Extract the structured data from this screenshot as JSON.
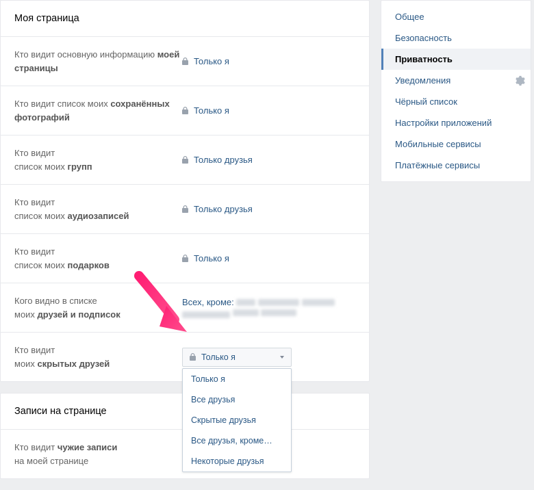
{
  "mypage": {
    "header": "Моя страница",
    "rows": [
      {
        "label_pre": "Кто видит основную информацию ",
        "label_bold": "моей страницы",
        "value": "Только я",
        "lock": true
      },
      {
        "label_pre": "Кто видит список моих ",
        "label_bold": "сохранённых фотографий",
        "value": "Только я",
        "lock": true
      },
      {
        "label_pre": "Кто видит\nсписок моих ",
        "label_bold": "групп",
        "value": "Только друзья",
        "lock": true
      },
      {
        "label_pre": "Кто видит\nсписок моих ",
        "label_bold": "аудиозаписей",
        "value": "Только друзья",
        "lock": true
      },
      {
        "label_pre": "Кто видит\nсписок моих ",
        "label_bold": "подарков",
        "value": "Только я",
        "lock": true
      },
      {
        "label_pre": "Кого видно в списке\nмоих ",
        "label_bold": "друзей и подписок",
        "value": "Всех, кроме: ",
        "lock": false,
        "blurred": true
      },
      {
        "label_pre": "Кто видит\nмоих ",
        "label_bold": "скрытых друзей",
        "dropdown": true
      }
    ]
  },
  "dropdown": {
    "selected": "Только я",
    "options": [
      "Только я",
      "Все друзья",
      "Скрытые друзья",
      "Все друзья, кроме…",
      "Некоторые друзья"
    ]
  },
  "posts": {
    "header": "Записи на странице",
    "rows": [
      {
        "label_pre": "Кто видит ",
        "label_bold": "чужие записи",
        "label_post": "\nна моей странице",
        "value": ""
      }
    ]
  },
  "sidebar": {
    "items": [
      {
        "label": "Общее"
      },
      {
        "label": "Безопасность"
      },
      {
        "label": "Приватность",
        "active": true
      },
      {
        "label": "Уведомления",
        "gear": true
      },
      {
        "label": "Чёрный список"
      },
      {
        "label": "Настройки приложений"
      },
      {
        "label": "Мобильные сервисы"
      },
      {
        "label": "Платёжные сервисы"
      }
    ]
  }
}
